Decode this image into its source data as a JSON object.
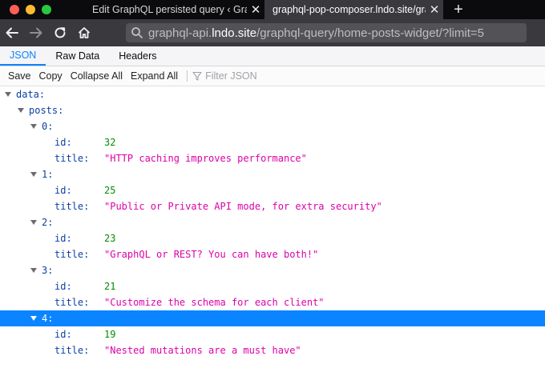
{
  "browser": {
    "tabs": [
      {
        "title": "Edit GraphQL persisted query ‹ Gra",
        "active": false
      },
      {
        "title": "graphql-pop-composer.lndo.site/gra",
        "active": true
      }
    ],
    "new_tab_label": "+",
    "url": {
      "prefix": "graphql-api.",
      "host": "lndo.site",
      "path": "/graphql-query/home-posts-widget/?limit=5"
    }
  },
  "viewer": {
    "tabs": [
      "JSON",
      "Raw Data",
      "Headers"
    ],
    "selected_tab": "JSON",
    "toolbar": {
      "save": "Save",
      "copy": "Copy",
      "collapse_all": "Collapse All",
      "expand_all": "Expand All",
      "filter_placeholder": "Filter JSON"
    }
  },
  "json": {
    "root_key": "data:",
    "list_key": "posts:",
    "field_id": "id:",
    "field_title": "title:",
    "posts": [
      {
        "index": "0:",
        "id": "32",
        "title": "\"HTTP caching improves performance\""
      },
      {
        "index": "1:",
        "id": "25",
        "title": "\"Public or Private API mode, for extra security\""
      },
      {
        "index": "2:",
        "id": "23",
        "title": "\"GraphQL or REST? You can have both!\""
      },
      {
        "index": "3:",
        "id": "21",
        "title": "\"Customize the schema for each client\""
      },
      {
        "index": "4:",
        "id": "19",
        "title": "\"Nested mutations are a must have\"",
        "selected": true
      }
    ]
  },
  "colors": {
    "accent": "#0a84ff",
    "key": "#0b3fa5",
    "number": "#058b00",
    "string": "#dd00a9"
  }
}
